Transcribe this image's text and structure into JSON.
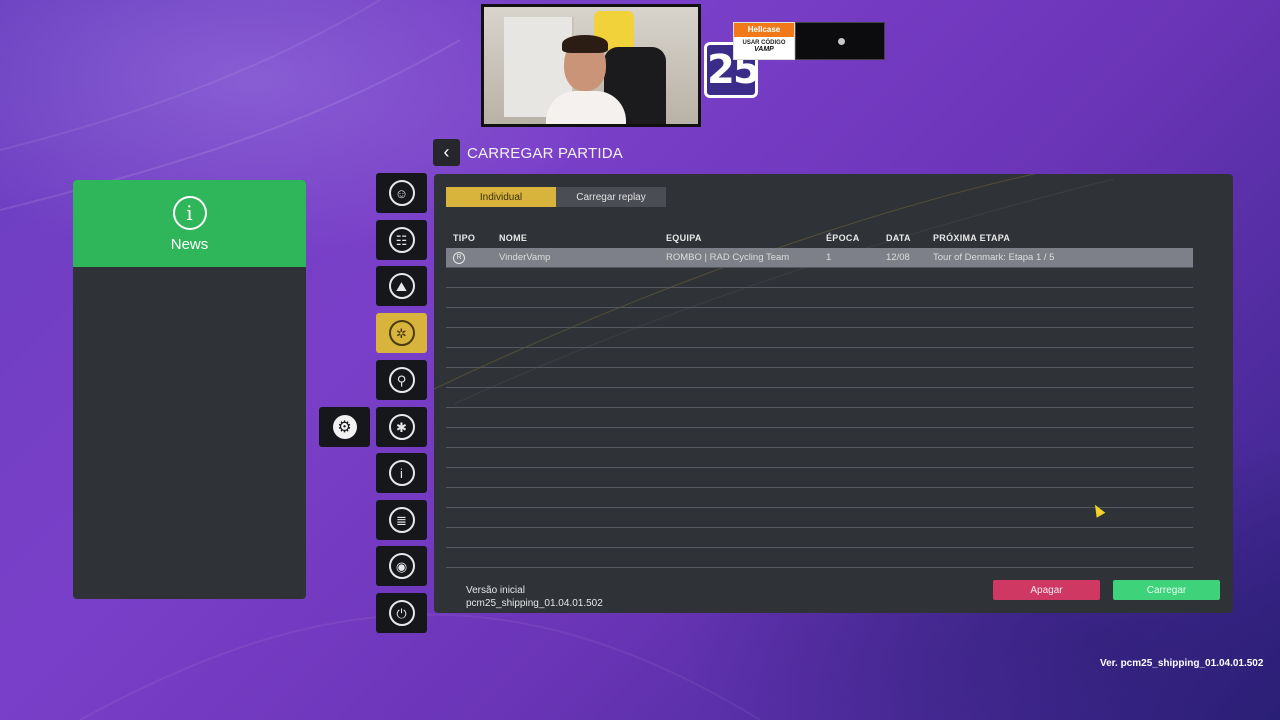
{
  "overlay": {
    "sponsor_brand": "Hellcase",
    "sponsor_code_label": "USAR CÓDIGO",
    "sponsor_code": "VAMP",
    "logo_number": "25"
  },
  "header": {
    "back_glyph": "‹",
    "title": "CARREGAR PARTIDA"
  },
  "news": {
    "icon_glyph": "i",
    "label": "News"
  },
  "sidebar": {
    "items": [
      {
        "icon": "person-icon",
        "glyph": "☺"
      },
      {
        "icon": "team-icon",
        "glyph": "☷"
      },
      {
        "icon": "mountain-icon",
        "glyph": "⛰"
      },
      {
        "icon": "cycling-icon",
        "glyph": "✲"
      },
      {
        "icon": "pin-icon",
        "glyph": "⚲"
      },
      {
        "icon": "rider-icon",
        "glyph": "✱"
      },
      {
        "icon": "info-icon",
        "glyph": "i"
      },
      {
        "icon": "document-icon",
        "glyph": "≣"
      },
      {
        "icon": "steam-icon",
        "glyph": "◉"
      },
      {
        "icon": "power-icon",
        "glyph": "⏻"
      }
    ],
    "active_index": 3,
    "settings_glyph": "⚙"
  },
  "tabs": [
    {
      "label": "Individual",
      "active": true
    },
    {
      "label": "Carregar replay",
      "active": false
    }
  ],
  "table": {
    "headers": {
      "tipo": "TIPO",
      "nome": "NOME",
      "equipa": "EQUIPA",
      "epoca": "ÉPOCA",
      "data": "DATA",
      "prox": "PRÓXIMA ETAPA"
    },
    "rows": [
      {
        "tipo_glyph": "R",
        "nome": "VinderVamp",
        "equipa": "ROMBO | RAD Cycling Team",
        "epoca": "1",
        "data": "12/08",
        "prox": "Tour of Denmark: Etapa 1 / 5"
      }
    ]
  },
  "version": {
    "line1": "Versão inicial",
    "line2": "pcm25_shipping_01.04.01.502"
  },
  "actions": {
    "delete_label": "Apagar",
    "load_label": "Carregar"
  },
  "footer": {
    "version": "Ver. pcm25_shipping_01.04.01.502"
  },
  "colors": {
    "accent_yellow": "#d8b43c",
    "news_green": "#2fb65a",
    "delete_red": "#d03864",
    "load_green": "#3ed27a",
    "panel": "#2f3237"
  }
}
